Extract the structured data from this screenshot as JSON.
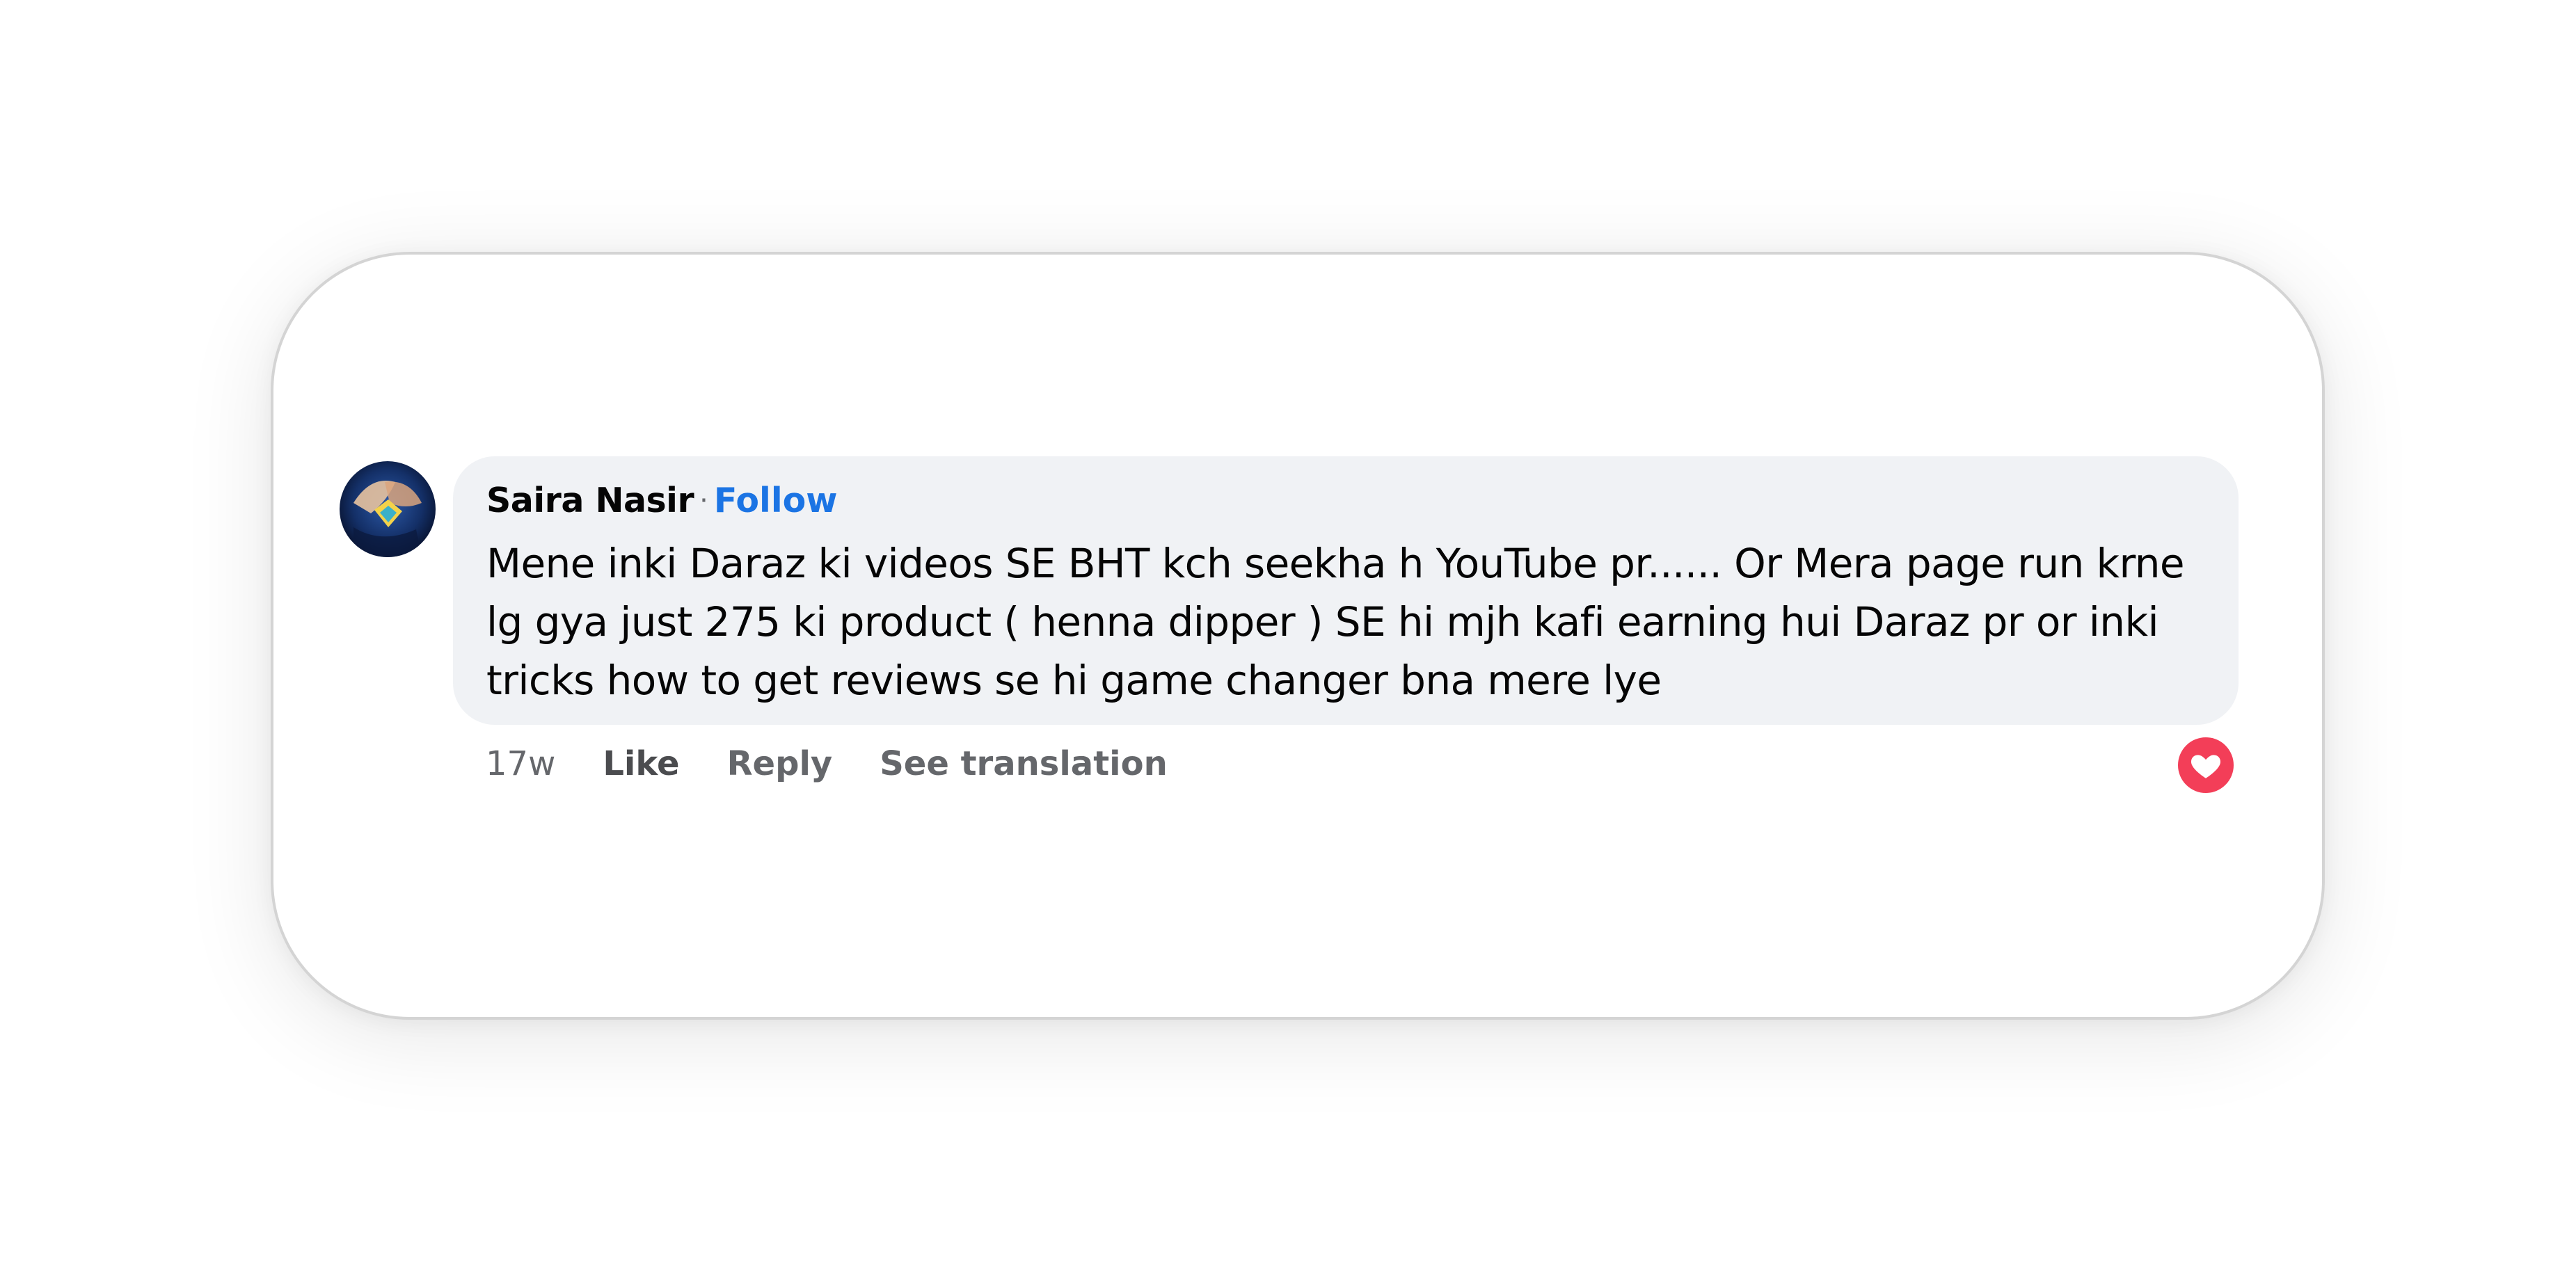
{
  "comment": {
    "author": "Saira Nasir",
    "separator": "·",
    "follow_label": "Follow",
    "text": "Mene inki Daraz ki videos SE BHT kch seekha h YouTube pr...... Or Mera page run krne lg gya just 275 ki product ( henna dipper ) SE hi mjh kafi earning hui Daraz pr or inki tricks how to get reviews se hi game changer bna mere lye",
    "actions": {
      "time": "17w",
      "like": "Like",
      "reply": "Reply",
      "translate": "See translation"
    },
    "reaction": {
      "icon": "heart-icon",
      "color": "#f33e58"
    }
  },
  "colors": {
    "bubble": "#f0f2f5",
    "follow": "#1b74e4",
    "muted": "#65676b"
  }
}
